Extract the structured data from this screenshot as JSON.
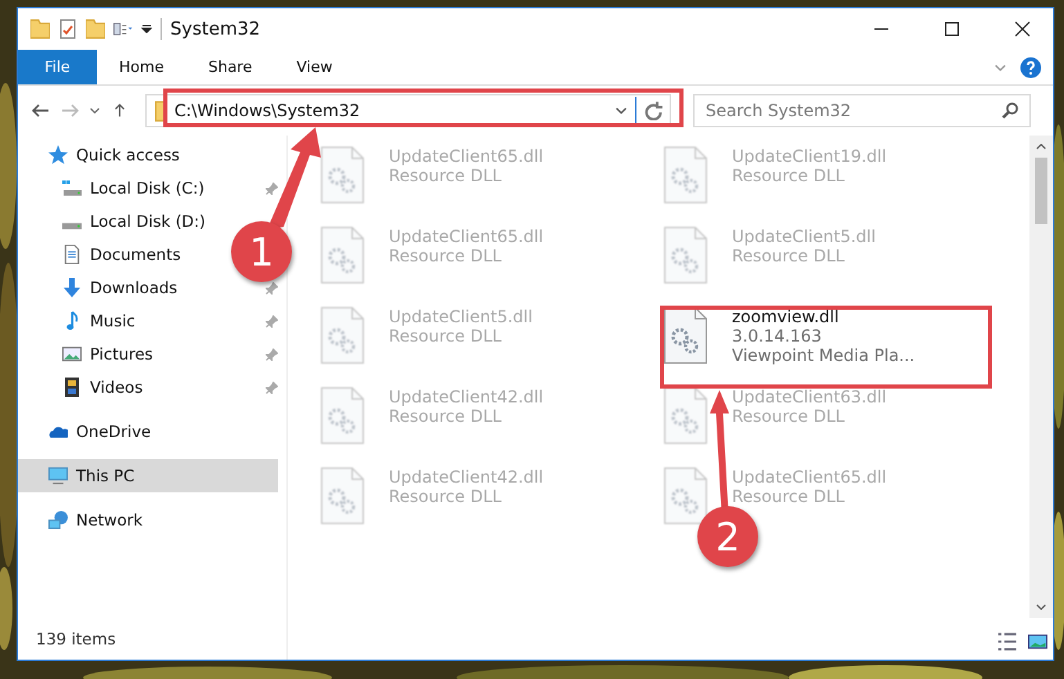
{
  "window": {
    "title": "System32"
  },
  "ribbon_tabs": [
    {
      "label": "File",
      "selected": true
    },
    {
      "label": "Home",
      "selected": false
    },
    {
      "label": "Share",
      "selected": false
    },
    {
      "label": "View",
      "selected": false
    }
  ],
  "address_bar": {
    "value": "C:\\Windows\\System32"
  },
  "search": {
    "placeholder": "Search System32"
  },
  "sidebar": {
    "items": [
      {
        "label": "Quick access",
        "kind": "star",
        "selected": false,
        "children": [
          {
            "label": "Local Disk (C:)",
            "kind": "drive-c",
            "pinned": true,
            "selected": false
          },
          {
            "label": "Local Disk (D:)",
            "kind": "drive",
            "pinned": false,
            "selected": false
          },
          {
            "label": "Documents",
            "kind": "documents",
            "pinned": false,
            "selected": false
          },
          {
            "label": "Downloads",
            "kind": "downloads",
            "pinned": true,
            "selected": false
          },
          {
            "label": "Music",
            "kind": "music",
            "pinned": true,
            "selected": false
          },
          {
            "label": "Pictures",
            "kind": "pictures",
            "pinned": true,
            "selected": false
          },
          {
            "label": "Videos",
            "kind": "videos",
            "pinned": true,
            "selected": false
          }
        ]
      },
      {
        "label": "OneDrive",
        "kind": "cloud",
        "selected": false
      },
      {
        "label": "This PC",
        "kind": "pc",
        "selected": true
      },
      {
        "label": "Network",
        "kind": "network",
        "selected": false
      }
    ]
  },
  "files": [
    {
      "lines": [
        "UpdateClient65.dll",
        "Resource DLL"
      ],
      "blurred": true
    },
    {
      "lines": [
        "UpdateClient19.dll",
        "Resource DLL"
      ],
      "blurred": true
    },
    {
      "lines": [
        "UpdateClient65.dll",
        "Resource DLL"
      ],
      "blurred": true
    },
    {
      "lines": [
        "UpdateClient5.dll",
        "Resource DLL"
      ],
      "blurred": true
    },
    {
      "lines": [
        "UpdateClient5.dll",
        "Resource DLL"
      ],
      "blurred": true
    },
    {
      "lines": [
        "zoomview.dll",
        "3.0.14.163",
        "Viewpoint Media Pla..."
      ],
      "blurred": false
    },
    {
      "lines": [
        "UpdateClient42.dll",
        "Resource DLL"
      ],
      "blurred": true
    },
    {
      "lines": [
        "UpdateClient63.dll",
        "Resource DLL"
      ],
      "blurred": true
    },
    {
      "lines": [
        "UpdateClient42.dll",
        "Resource DLL"
      ],
      "blurred": true
    },
    {
      "lines": [
        "UpdateClient65.dll",
        "Resource DLL"
      ],
      "blurred": true
    }
  ],
  "status_bar": {
    "item_count": "139 items"
  },
  "callouts": [
    {
      "number": "1"
    },
    {
      "number": "2"
    }
  ]
}
